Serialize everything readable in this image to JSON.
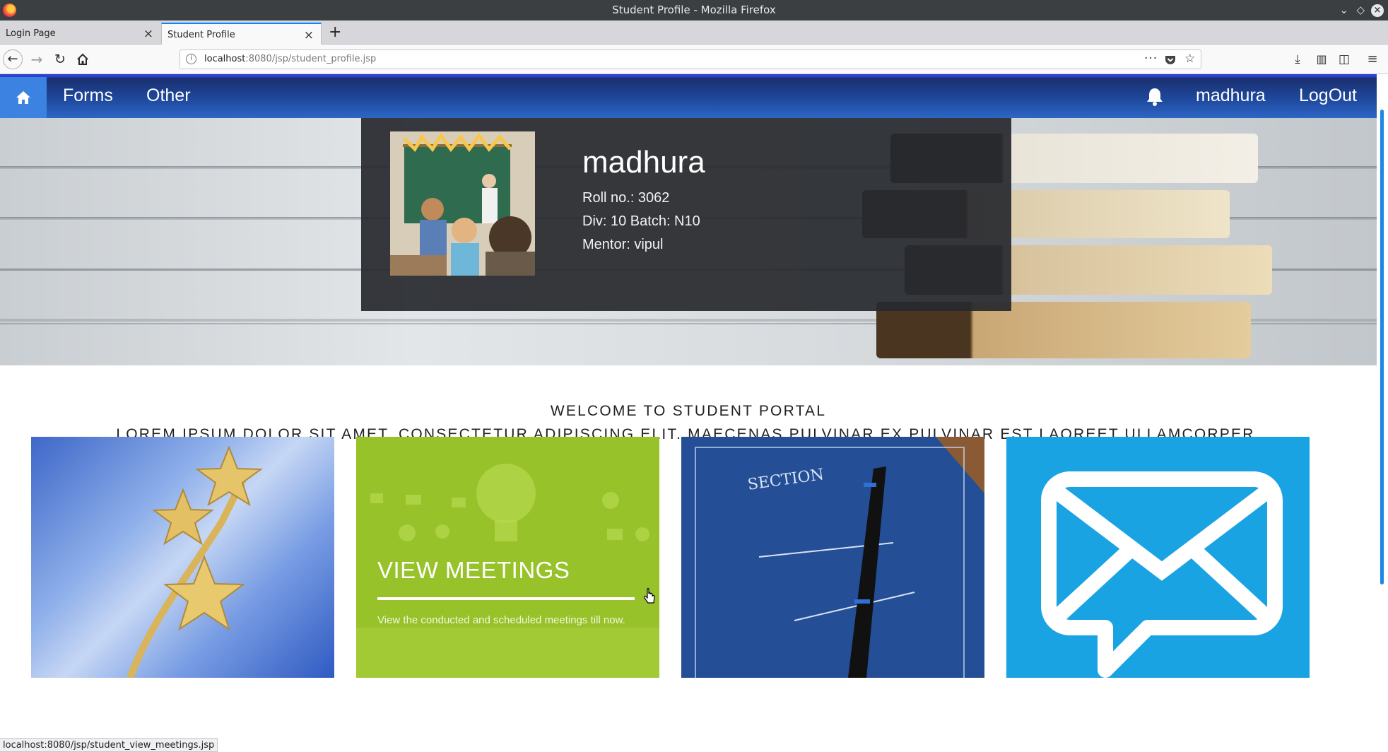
{
  "window": {
    "title": "Student Profile - Mozilla Firefox"
  },
  "tabs": [
    {
      "label": "Login Page",
      "active": false
    },
    {
      "label": "Student Profile",
      "active": true
    }
  ],
  "url": {
    "host": "localhost",
    "rest": ":8080/jsp/student_profile.jsp"
  },
  "nav": {
    "items": [
      {
        "label": "Forms"
      },
      {
        "label": "Other"
      }
    ],
    "username": "madhura",
    "logout": "LogOut"
  },
  "profile": {
    "name": "madhura",
    "roll": "Roll no.: 3062",
    "div_batch": "Div: 10 Batch: N10",
    "mentor": "Mentor: vipul"
  },
  "welcome": {
    "line1": "WELCOME TO STUDENT PORTAL",
    "line2": "LOREM IPSUM DOLOR SIT AMET, CONSECTETUR ADIPISCING ELIT. MAECENAS PULVINAR EX PULVINAR EST LAOREET ULLAMCORPER."
  },
  "cards": [
    {
      "image": "gold-stars"
    },
    {
      "title": "VIEW MEETINGS",
      "description": "View the conducted and scheduled meetings till now.",
      "image": "meetings-lightbulb"
    },
    {
      "image": "notebook-pen",
      "cover_text": "SECTION"
    },
    {
      "image": "mail-icon"
    }
  ],
  "status": "localhost:8080/jsp/student_view_meetings.jsp",
  "colors": {
    "nav_dark": "#1f4aa0",
    "home_btn": "#3c82e0",
    "card_green": "#97c229",
    "card_blue": "#1aa3e3"
  }
}
